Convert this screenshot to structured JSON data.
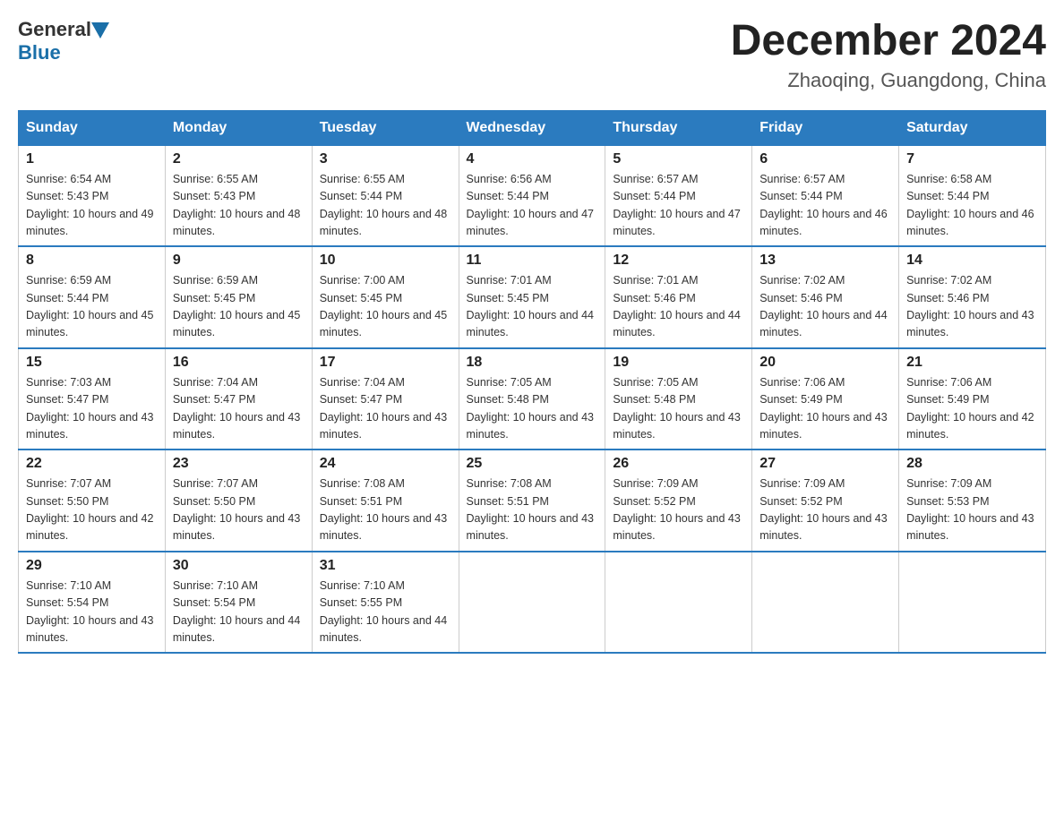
{
  "header": {
    "logo_general": "General",
    "logo_blue": "Blue",
    "title": "December 2024",
    "subtitle": "Zhaoqing, Guangdong, China"
  },
  "weekdays": [
    "Sunday",
    "Monday",
    "Tuesday",
    "Wednesday",
    "Thursday",
    "Friday",
    "Saturday"
  ],
  "weeks": [
    [
      {
        "day": "1",
        "sunrise": "6:54 AM",
        "sunset": "5:43 PM",
        "daylight": "10 hours and 49 minutes."
      },
      {
        "day": "2",
        "sunrise": "6:55 AM",
        "sunset": "5:43 PM",
        "daylight": "10 hours and 48 minutes."
      },
      {
        "day": "3",
        "sunrise": "6:55 AM",
        "sunset": "5:44 PM",
        "daylight": "10 hours and 48 minutes."
      },
      {
        "day": "4",
        "sunrise": "6:56 AM",
        "sunset": "5:44 PM",
        "daylight": "10 hours and 47 minutes."
      },
      {
        "day": "5",
        "sunrise": "6:57 AM",
        "sunset": "5:44 PM",
        "daylight": "10 hours and 47 minutes."
      },
      {
        "day": "6",
        "sunrise": "6:57 AM",
        "sunset": "5:44 PM",
        "daylight": "10 hours and 46 minutes."
      },
      {
        "day": "7",
        "sunrise": "6:58 AM",
        "sunset": "5:44 PM",
        "daylight": "10 hours and 46 minutes."
      }
    ],
    [
      {
        "day": "8",
        "sunrise": "6:59 AM",
        "sunset": "5:44 PM",
        "daylight": "10 hours and 45 minutes."
      },
      {
        "day": "9",
        "sunrise": "6:59 AM",
        "sunset": "5:45 PM",
        "daylight": "10 hours and 45 minutes."
      },
      {
        "day": "10",
        "sunrise": "7:00 AM",
        "sunset": "5:45 PM",
        "daylight": "10 hours and 45 minutes."
      },
      {
        "day": "11",
        "sunrise": "7:01 AM",
        "sunset": "5:45 PM",
        "daylight": "10 hours and 44 minutes."
      },
      {
        "day": "12",
        "sunrise": "7:01 AM",
        "sunset": "5:46 PM",
        "daylight": "10 hours and 44 minutes."
      },
      {
        "day": "13",
        "sunrise": "7:02 AM",
        "sunset": "5:46 PM",
        "daylight": "10 hours and 44 minutes."
      },
      {
        "day": "14",
        "sunrise": "7:02 AM",
        "sunset": "5:46 PM",
        "daylight": "10 hours and 43 minutes."
      }
    ],
    [
      {
        "day": "15",
        "sunrise": "7:03 AM",
        "sunset": "5:47 PM",
        "daylight": "10 hours and 43 minutes."
      },
      {
        "day": "16",
        "sunrise": "7:04 AM",
        "sunset": "5:47 PM",
        "daylight": "10 hours and 43 minutes."
      },
      {
        "day": "17",
        "sunrise": "7:04 AM",
        "sunset": "5:47 PM",
        "daylight": "10 hours and 43 minutes."
      },
      {
        "day": "18",
        "sunrise": "7:05 AM",
        "sunset": "5:48 PM",
        "daylight": "10 hours and 43 minutes."
      },
      {
        "day": "19",
        "sunrise": "7:05 AM",
        "sunset": "5:48 PM",
        "daylight": "10 hours and 43 minutes."
      },
      {
        "day": "20",
        "sunrise": "7:06 AM",
        "sunset": "5:49 PM",
        "daylight": "10 hours and 43 minutes."
      },
      {
        "day": "21",
        "sunrise": "7:06 AM",
        "sunset": "5:49 PM",
        "daylight": "10 hours and 42 minutes."
      }
    ],
    [
      {
        "day": "22",
        "sunrise": "7:07 AM",
        "sunset": "5:50 PM",
        "daylight": "10 hours and 42 minutes."
      },
      {
        "day": "23",
        "sunrise": "7:07 AM",
        "sunset": "5:50 PM",
        "daylight": "10 hours and 43 minutes."
      },
      {
        "day": "24",
        "sunrise": "7:08 AM",
        "sunset": "5:51 PM",
        "daylight": "10 hours and 43 minutes."
      },
      {
        "day": "25",
        "sunrise": "7:08 AM",
        "sunset": "5:51 PM",
        "daylight": "10 hours and 43 minutes."
      },
      {
        "day": "26",
        "sunrise": "7:09 AM",
        "sunset": "5:52 PM",
        "daylight": "10 hours and 43 minutes."
      },
      {
        "day": "27",
        "sunrise": "7:09 AM",
        "sunset": "5:52 PM",
        "daylight": "10 hours and 43 minutes."
      },
      {
        "day": "28",
        "sunrise": "7:09 AM",
        "sunset": "5:53 PM",
        "daylight": "10 hours and 43 minutes."
      }
    ],
    [
      {
        "day": "29",
        "sunrise": "7:10 AM",
        "sunset": "5:54 PM",
        "daylight": "10 hours and 43 minutes."
      },
      {
        "day": "30",
        "sunrise": "7:10 AM",
        "sunset": "5:54 PM",
        "daylight": "10 hours and 44 minutes."
      },
      {
        "day": "31",
        "sunrise": "7:10 AM",
        "sunset": "5:55 PM",
        "daylight": "10 hours and 44 minutes."
      },
      null,
      null,
      null,
      null
    ]
  ]
}
